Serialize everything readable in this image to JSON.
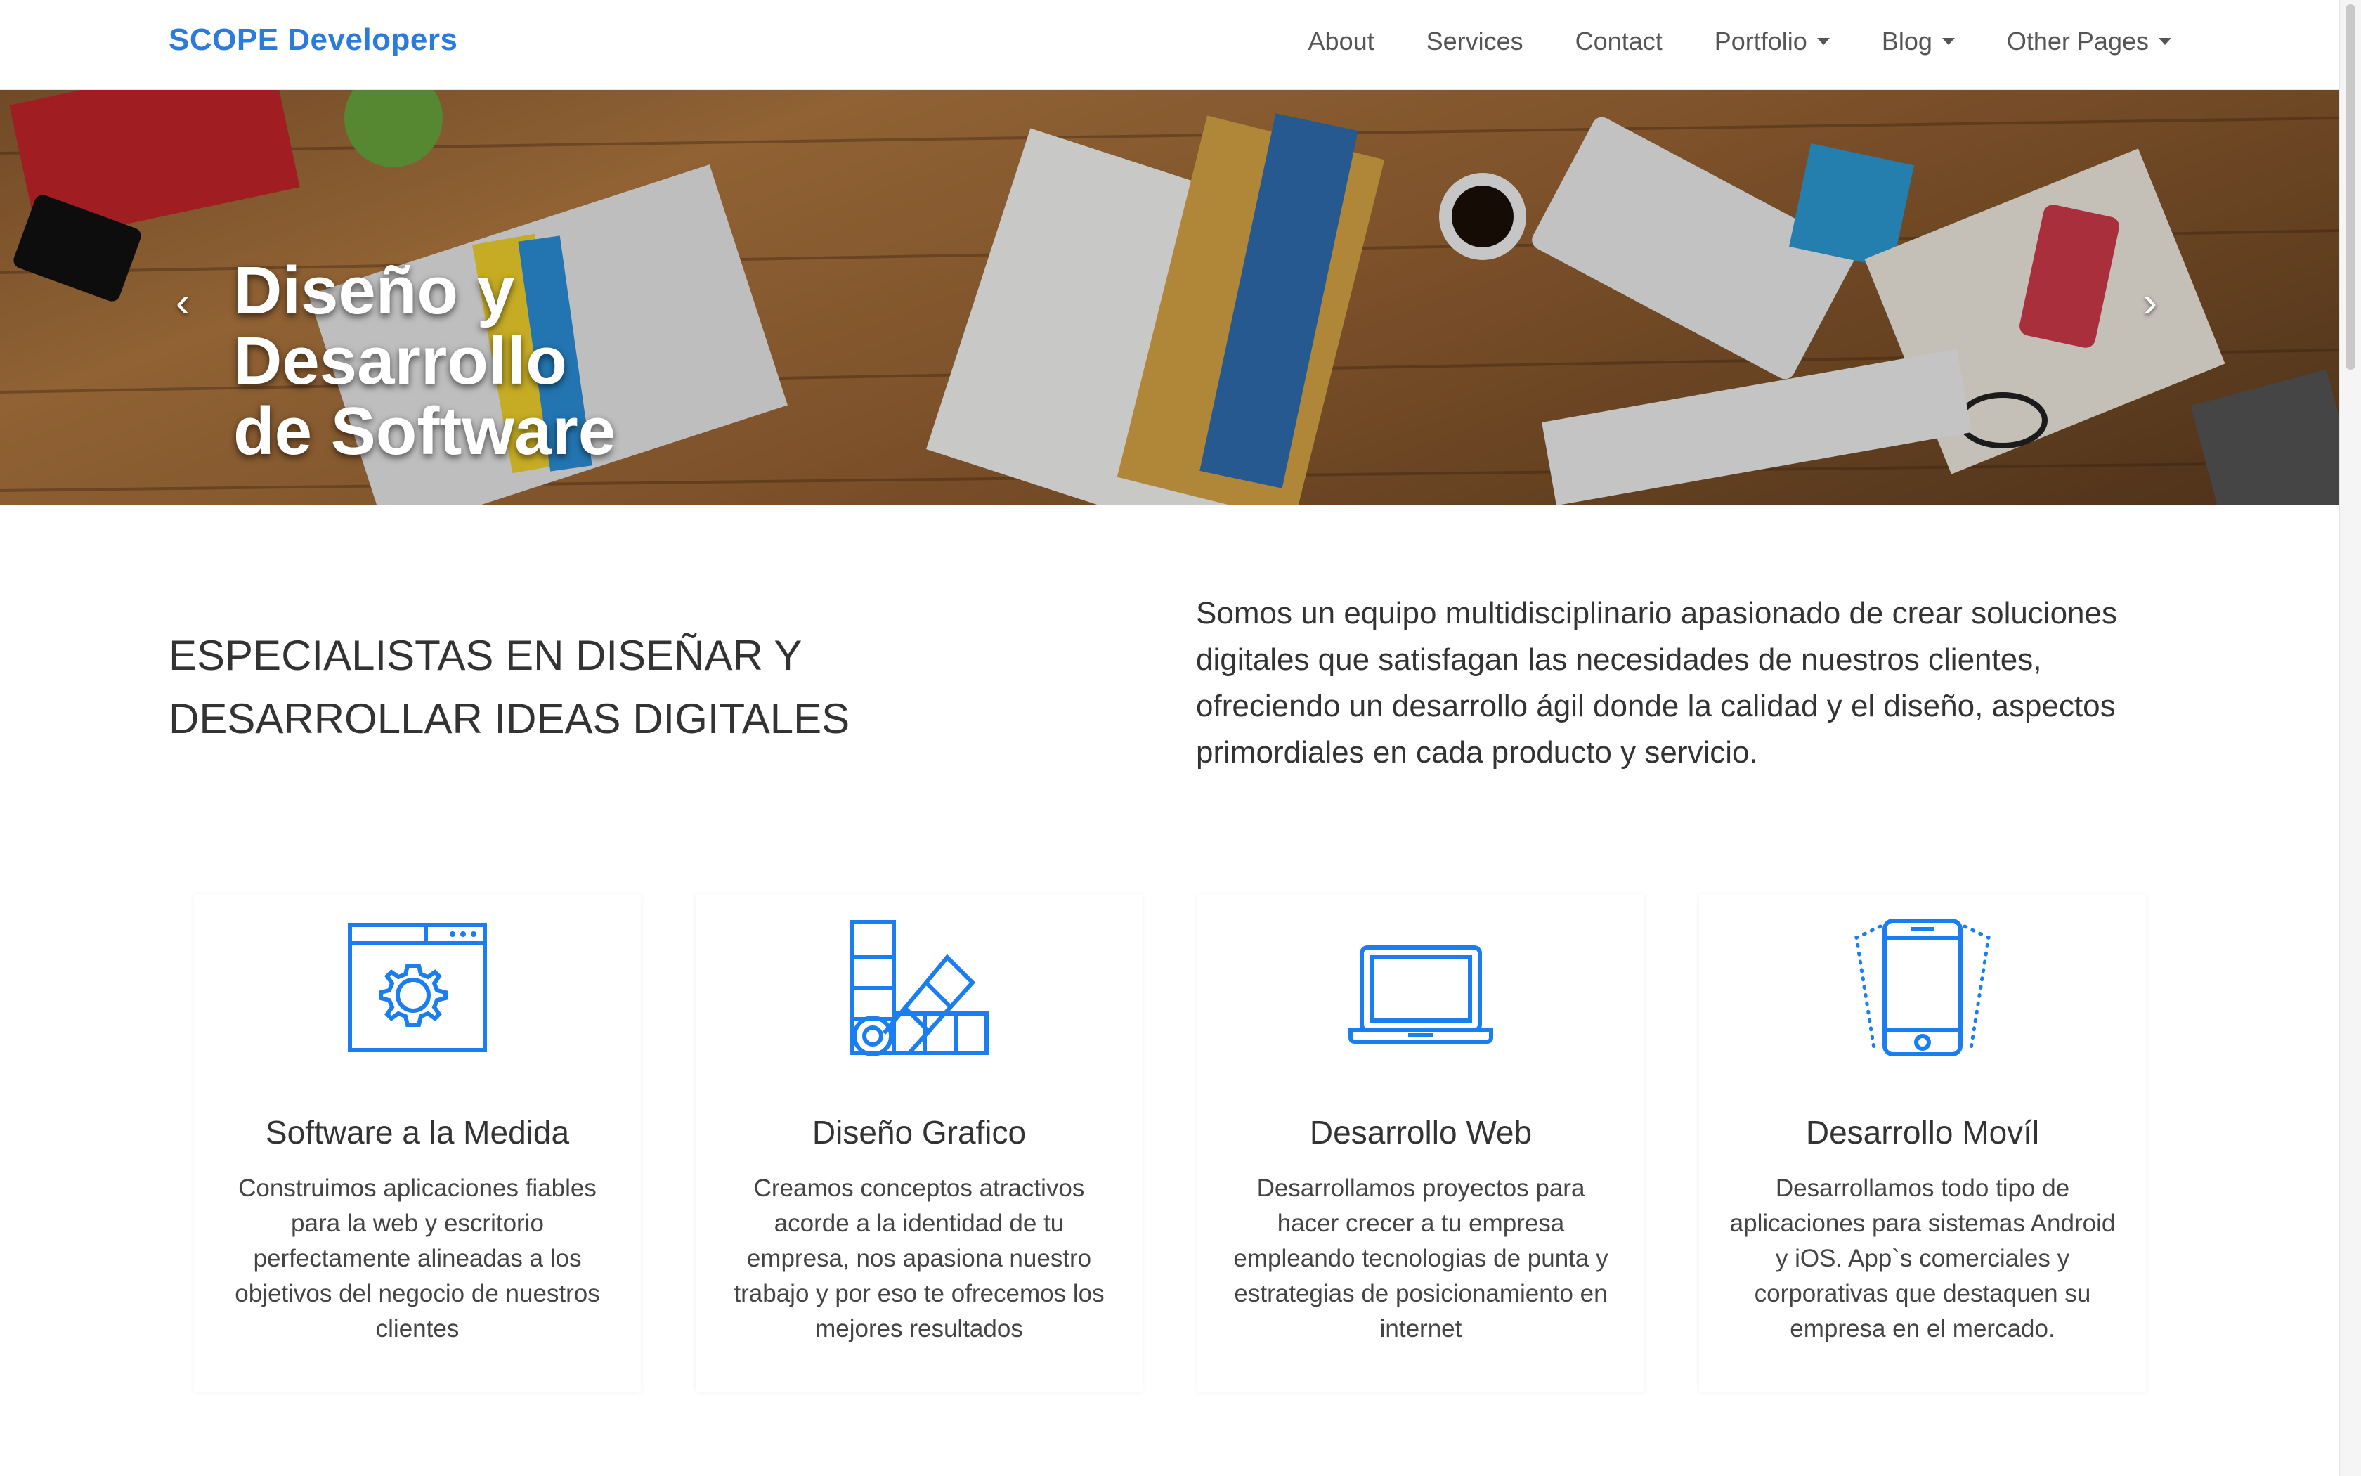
{
  "brand": "SCOPE Developers",
  "nav": {
    "about": "About",
    "services": "Services",
    "contact": "Contact",
    "portfolio": "Portfolio",
    "blog": "Blog",
    "other": "Other Pages"
  },
  "hero": {
    "title_line1": "Diseño y Desarrollo",
    "title_line2": "de Software",
    "prev_arrow": "‹",
    "next_arrow": "›",
    "slides": 3,
    "active_slide": 1
  },
  "intro": {
    "heading_line1": "ESPECIALISTAS EN DISEÑAR Y",
    "heading_line2": "DESARROLLAR IDEAS DIGITALES",
    "text": "Somos un equipo multidisciplinario apasionado de crear soluciones digitales que satisfagan las necesidades de nuestros clientes, ofreciendo un desarrollo ágil donde la calidad y el diseño, aspectos primordiales en cada producto y servicio."
  },
  "services": [
    {
      "icon": "software-window-gear-icon",
      "title": "Software a la Medida",
      "text": "Construimos aplicaciones fiables para la web y escritorio perfectamente alineadas a los objetivos del negocio de nuestros clientes"
    },
    {
      "icon": "color-swatch-icon",
      "title": "Diseño Grafico",
      "text": "Creamos conceptos atractivos acorde a la identidad de tu empresa, nos apasiona nuestro trabajo y por eso te ofrecemos los mejores resultados"
    },
    {
      "icon": "laptop-icon",
      "title": "Desarrollo Web",
      "text": "Desarrollamos proyectos para hacer crecer a tu empresa empleando tecnologias de punta y estrategias de posicionamiento en internet"
    },
    {
      "icon": "smartphone-icon",
      "title": "Desarrollo Movíl",
      "text": "Desarrollamos todo tipo de aplicaciones para sistemas Android y iOS. App`s comerciales y corporativas que destaquen su empresa en el mercado."
    }
  ],
  "colors": {
    "accent": "#2b7bdc",
    "icon_blue": "#1a7df0",
    "text": "#333333"
  }
}
